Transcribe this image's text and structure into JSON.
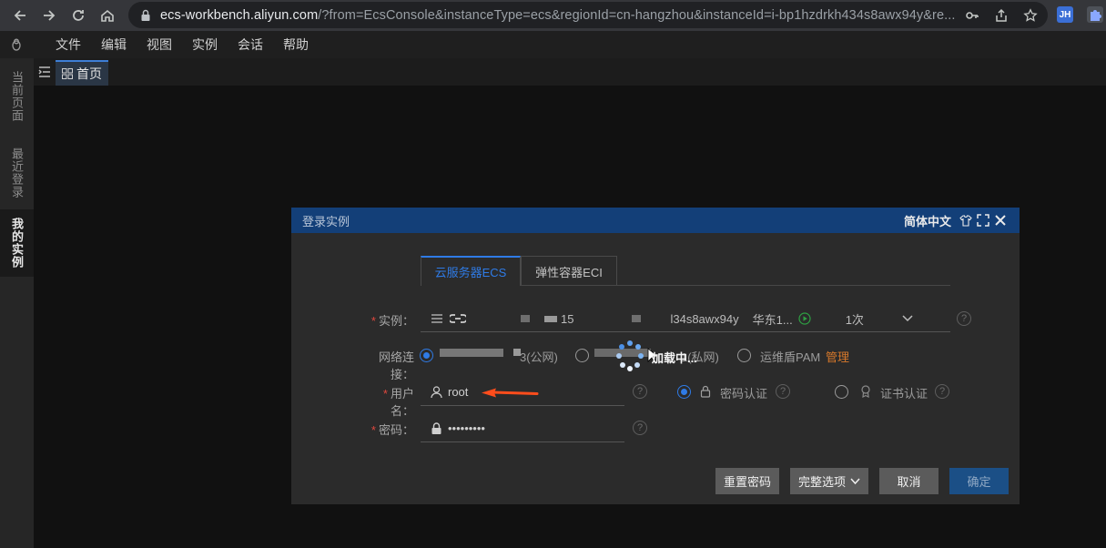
{
  "browser": {
    "url_host": "ecs-workbench.aliyun.com",
    "url_rest": "/?from=EcsConsole&instanceType=ecs&regionId=cn-hangzhou&instanceId=i-bp1hzdrkh434s8awx94y&re...",
    "extension_label": "JH"
  },
  "menu": {
    "items": [
      "文件",
      "编辑",
      "视图",
      "实例",
      "会话",
      "帮助"
    ]
  },
  "rail": {
    "current_page": "当前页面",
    "recent_login": "最近登录",
    "my_instances": "我的实例"
  },
  "tabs": {
    "home": "首页"
  },
  "dialog": {
    "title": "登录实例",
    "language": "简体中文",
    "tab_ecs": "云服务器ECS",
    "tab_eci": "弹性容器ECI",
    "instance_label": "实例：",
    "instance_fragment_1": "15",
    "instance_id_fragment": "l34s8awx94y",
    "instance_region": "华东1...",
    "instance_count": "1次",
    "network_label": "网络连接：",
    "network_public": "3(公网)",
    "network_private": "1(私网)",
    "network_bastion": "运维盾PAM",
    "network_manage": "管理",
    "loading_text": "加载中...",
    "username_label": "用户名：",
    "username_value": "root",
    "auth_password": "密码认证",
    "auth_cert": "证书认证",
    "password_label": "密码：",
    "password_value": "•••••••••",
    "btn_reset": "重置密码",
    "btn_options": "完整选项",
    "btn_cancel": "取消",
    "btn_ok": "确定"
  },
  "colors": {
    "accent": "#2f7be6",
    "header": "#133f78",
    "manage_link": "#d6782b",
    "arrow": "#ff4d1c"
  }
}
